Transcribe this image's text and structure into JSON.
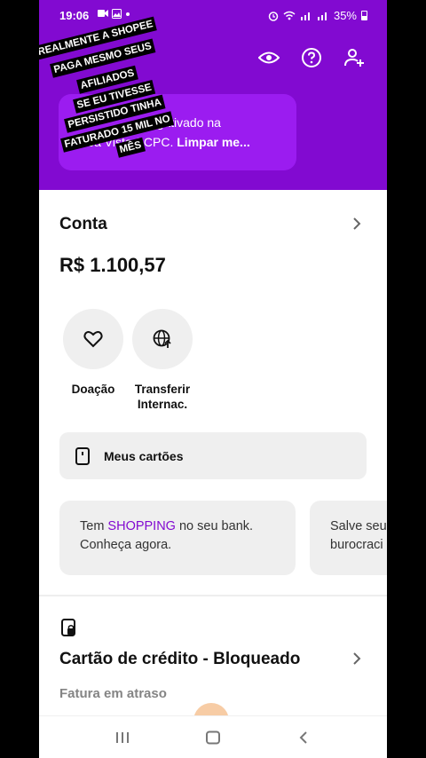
{
  "status_bar": {
    "time": "19:06",
    "battery": "35%"
  },
  "overlay_caption": [
    "REALMENTE A SHOPEE",
    "PAGA MESMO SEUS",
    "AFILIADOS",
    "SE EU TIVESSE",
    "PERSISTIDO TINHA",
    "FATURADO 15 MIL NO",
    "MÊS"
  ],
  "banner": {
    "line1": "negativado na",
    "line2_prefix": "Boa Vista SCPC.",
    "line2_link": "Limpar me..."
  },
  "account": {
    "title": "Conta",
    "balance": "R$ 1.100,57"
  },
  "actions": [
    {
      "label": "Doação",
      "icon": "heart-icon"
    },
    {
      "label_line1": "Transferir",
      "label_line2": "Internac.",
      "icon": "globe-transfer-icon"
    }
  ],
  "my_cards": {
    "label": "Meus cartões"
  },
  "promos": [
    {
      "pre": "Tem ",
      "highlight": "SHOPPING",
      "post": " no seu bank.",
      "line2": "Conheça agora."
    },
    {
      "line1": "Salve seu",
      "line2": "burocraci"
    }
  ],
  "credit_card": {
    "title": "Cartão de crédito - Bloqueado",
    "subtitle": "Fatura em atraso"
  },
  "colors": {
    "brand": "#820ad1",
    "banner": "#9b1cf0",
    "highlight": "#820ad1"
  }
}
